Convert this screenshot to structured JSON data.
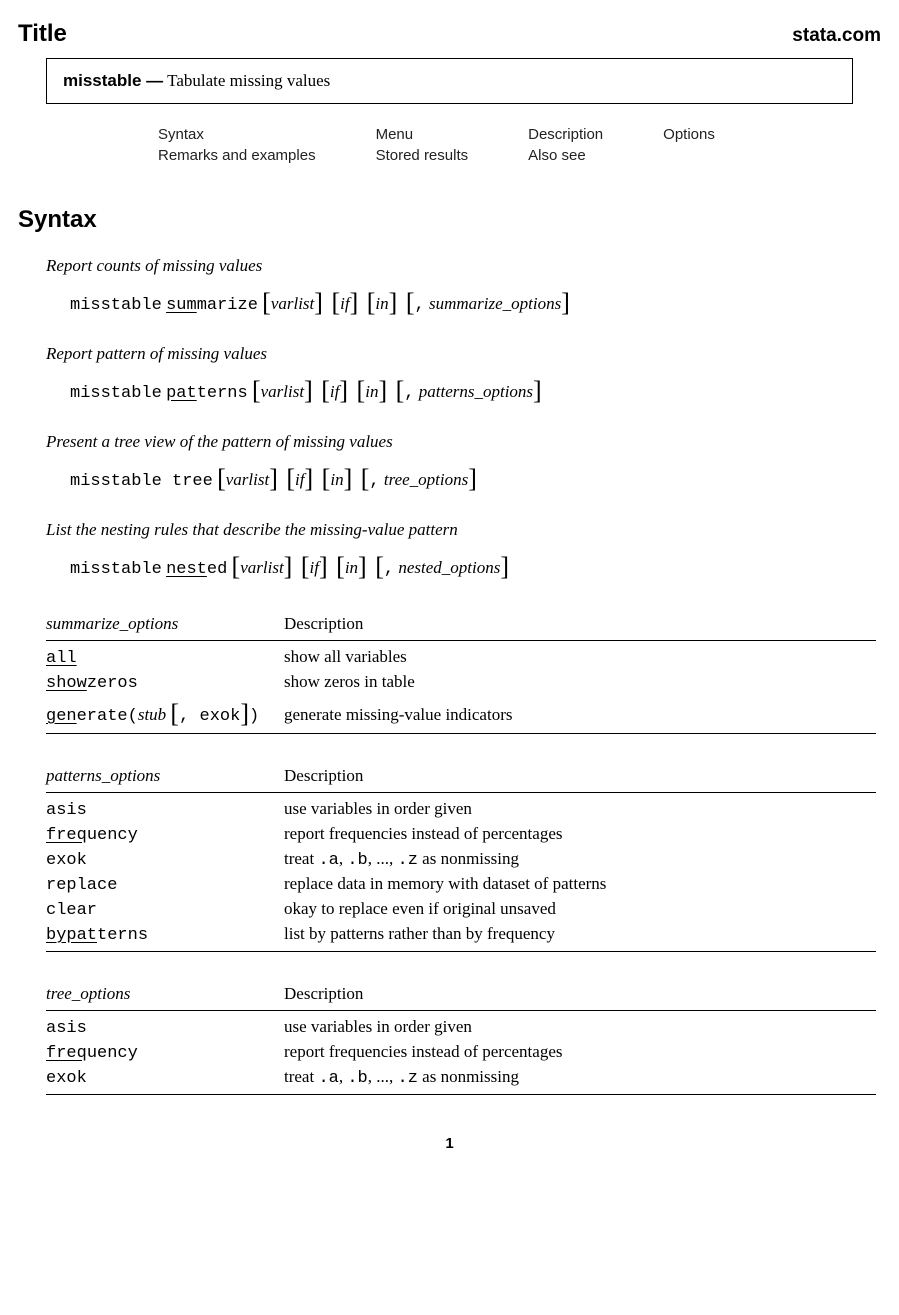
{
  "header": {
    "title": "Title",
    "brand": "stata.com"
  },
  "title_box": {
    "cmd": "misstable —",
    "desc": "Tabulate missing values"
  },
  "nav": {
    "r1": {
      "c1": "Syntax",
      "c2": "Menu",
      "c3": "Description",
      "c4": "Options"
    },
    "r2": {
      "c1": "Remarks and examples",
      "c2": "Stored results",
      "c3": "Also see",
      "c4": ""
    }
  },
  "section_syntax": "Syntax",
  "syntax_groups": [
    {
      "caption": "Report counts of missing values",
      "cmd": "misstable",
      "sub_ul": "sum",
      "sub_rest": "marize",
      "opts": "summarize_options"
    },
    {
      "caption": "Report pattern of missing values",
      "cmd": "misstable",
      "sub_ul": "pat",
      "sub_rest": "terns",
      "opts": "patterns_options"
    },
    {
      "caption": "Present a tree view of the pattern of missing values",
      "cmd": "misstable tree",
      "sub_ul": "",
      "sub_rest": "",
      "opts": "tree_options"
    },
    {
      "caption": "List the nesting rules that describe the missing-value pattern",
      "cmd": "misstable",
      "sub_ul": "nest",
      "sub_rest": "ed",
      "opts": "nested_options"
    }
  ],
  "common": {
    "varlist": "varlist",
    "if": "if",
    "in": "in",
    "comma": ","
  },
  "tables": {
    "summarize": {
      "head_opt": "summarize_options",
      "head_desc": "Description",
      "rows": [
        {
          "opt_ul": "all",
          "opt_rest": "",
          "desc": "show all variables"
        },
        {
          "opt_ul": "show",
          "opt_rest": "zeros",
          "desc": "show zeros in table"
        },
        {
          "opt_ul": "gen",
          "opt_rest": "erate(",
          "stub": "stub",
          "extra_pre": " ",
          "extra_tt": ", exok",
          "extra_post": ")",
          "desc": "generate missing-value indicators"
        }
      ]
    },
    "patterns": {
      "head_opt": "patterns_options",
      "head_desc": "Description",
      "rows": [
        {
          "opt": "asis",
          "desc": "use variables in order given"
        },
        {
          "opt_ul": "freq",
          "opt_rest": "uency",
          "desc": "report frequencies instead of percentages"
        },
        {
          "opt": "exok",
          "desc": "treat .a, .b, ..., .z as nonmissing",
          "desc_tt": true
        },
        {
          "opt": "replace",
          "desc": "replace data in memory with dataset of patterns"
        },
        {
          "opt": "clear",
          "desc": "okay to replace even if original unsaved"
        },
        {
          "opt_ul": "bypat",
          "opt_rest": "terns",
          "desc": "list by patterns rather than by frequency"
        }
      ]
    },
    "tree": {
      "head_opt": "tree_options",
      "head_desc": "Description",
      "rows": [
        {
          "opt": "asis",
          "desc": "use variables in order given"
        },
        {
          "opt_ul": "freq",
          "opt_rest": "uency",
          "desc": "report frequencies instead of percentages"
        },
        {
          "opt": "exok",
          "desc": "treat .a, .b, ..., .z as nonmissing",
          "desc_tt": true
        }
      ]
    }
  },
  "page_num": "1"
}
